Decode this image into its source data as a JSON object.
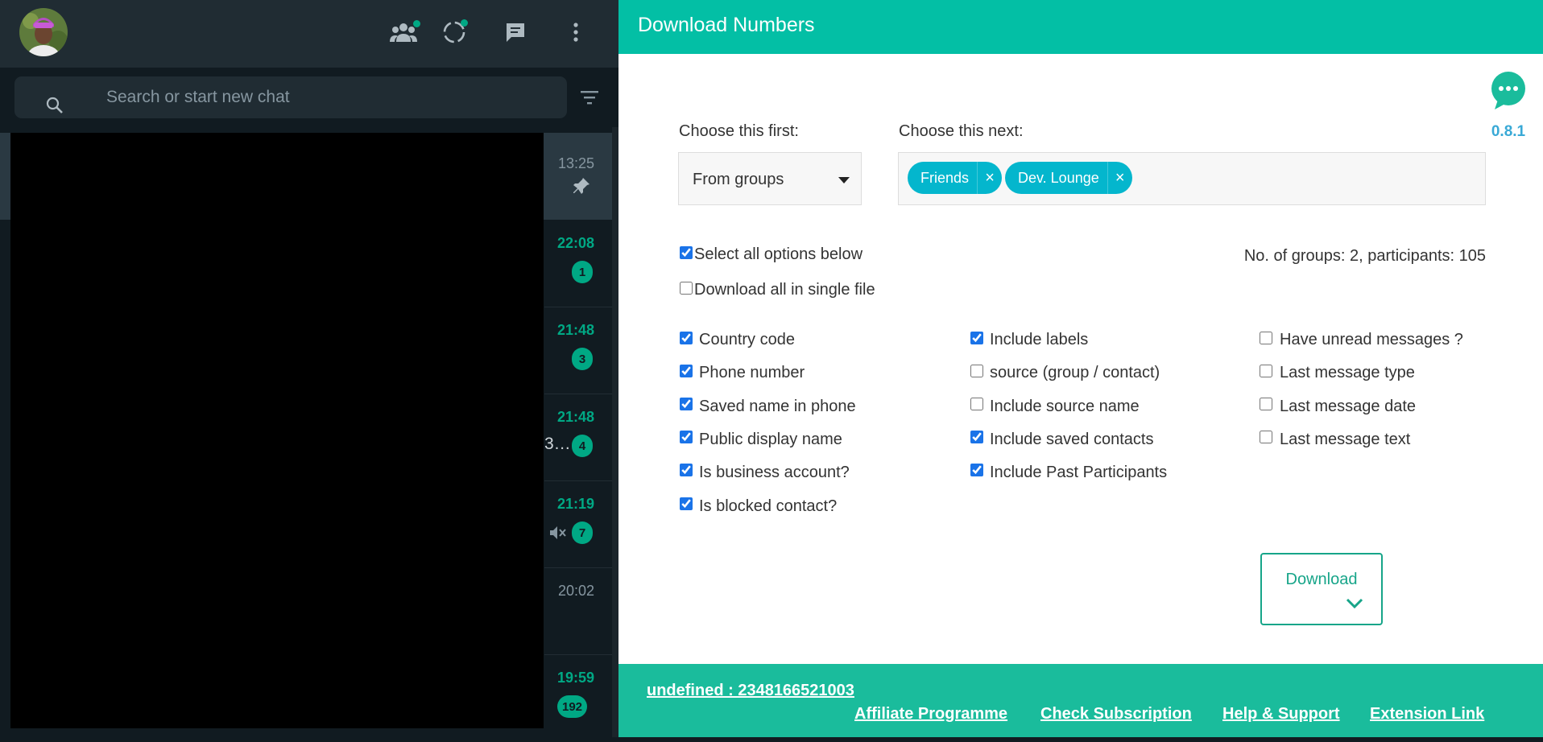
{
  "whatsapp": {
    "search": {
      "placeholder": "Search or start new chat"
    },
    "header_icons": [
      "communities-icon",
      "status-icon",
      "new-chat-icon",
      "menu-icon"
    ],
    "chats": [
      {
        "time": "13:25",
        "unread": false,
        "pinned": true,
        "badge": ""
      },
      {
        "time": "22:08",
        "unread": true,
        "badge": "1"
      },
      {
        "time": "21:48",
        "unread": true,
        "badge": "3"
      },
      {
        "time": "21:48",
        "unread": true,
        "badge": "4"
      },
      {
        "time": "21:19",
        "unread": true,
        "muted": true,
        "badge": "7"
      },
      {
        "time": "20:02",
        "unread": false,
        "badge": ""
      },
      {
        "time": "19:59",
        "unread": true,
        "badge": "192"
      }
    ],
    "preview_fragment": "3…"
  },
  "extension": {
    "title": "Download Numbers",
    "version": "0.8.1",
    "first_label": "Choose this first:",
    "first_value": "From groups",
    "next_label": "Choose this next:",
    "tags": [
      "Friends",
      "Dev. Lounge"
    ],
    "tag_remove": "×",
    "select_all_label": "Select all options below",
    "single_file_label": "Download all in single file",
    "group_info": "No. of groups: 2, participants: 105",
    "options": {
      "col1": [
        {
          "label": "Country code",
          "checked": true
        },
        {
          "label": "Phone number",
          "checked": true
        },
        {
          "label": "Saved name in phone",
          "checked": true
        },
        {
          "label": "Public display name",
          "checked": true
        },
        {
          "label": "Is business account?",
          "checked": true
        },
        {
          "label": "Is blocked contact?",
          "checked": true
        }
      ],
      "col2": [
        {
          "label": "Include labels",
          "checked": true
        },
        {
          "label": "source (group / contact)",
          "checked": false
        },
        {
          "label": "Include source name",
          "checked": false
        },
        {
          "label": "Include saved contacts",
          "checked": true
        },
        {
          "label": "Include Past Participants",
          "checked": true
        }
      ],
      "col3": [
        {
          "label": "Have unread messages ?",
          "checked": false
        },
        {
          "label": "Last message type",
          "checked": false
        },
        {
          "label": "Last message date",
          "checked": false
        },
        {
          "label": "Last message text",
          "checked": false
        }
      ]
    },
    "download_label": "Download",
    "footer": {
      "account": "undefined : 2348166521003",
      "links": [
        "Affiliate Programme",
        "Check Subscription",
        "Help & Support",
        "Extension Link"
      ]
    },
    "colors": {
      "header": "#03bfa5",
      "footer": "#1abc9c",
      "tag": "#04b6cd",
      "button": "#17a589",
      "version": "#39a9d6"
    }
  }
}
